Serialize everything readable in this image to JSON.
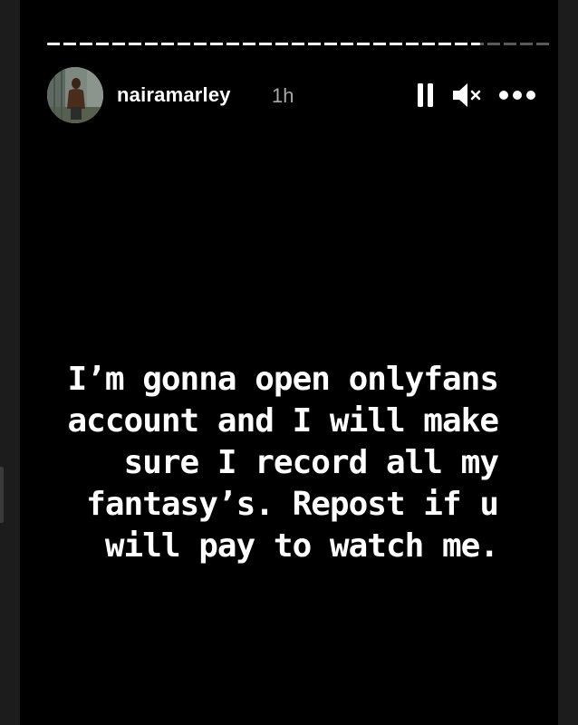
{
  "story": {
    "progress_segments": 1,
    "progress_fraction": 0.86
  },
  "header": {
    "username": "nairamarley",
    "time": "1h",
    "controls": {
      "pause_icon": "pause-icon",
      "mute_icon": "muted-speaker-icon",
      "more_icon": "more-dots-icon"
    }
  },
  "caption": {
    "lines": [
      "I’m gonna open onlyfans",
      "account and I will make",
      "sure I record all my",
      "fantasy’s. Repost if u",
      "will pay to watch me."
    ]
  },
  "colors": {
    "background": "#000000",
    "text": "#ffffff",
    "muted": "#a8a8a8"
  }
}
